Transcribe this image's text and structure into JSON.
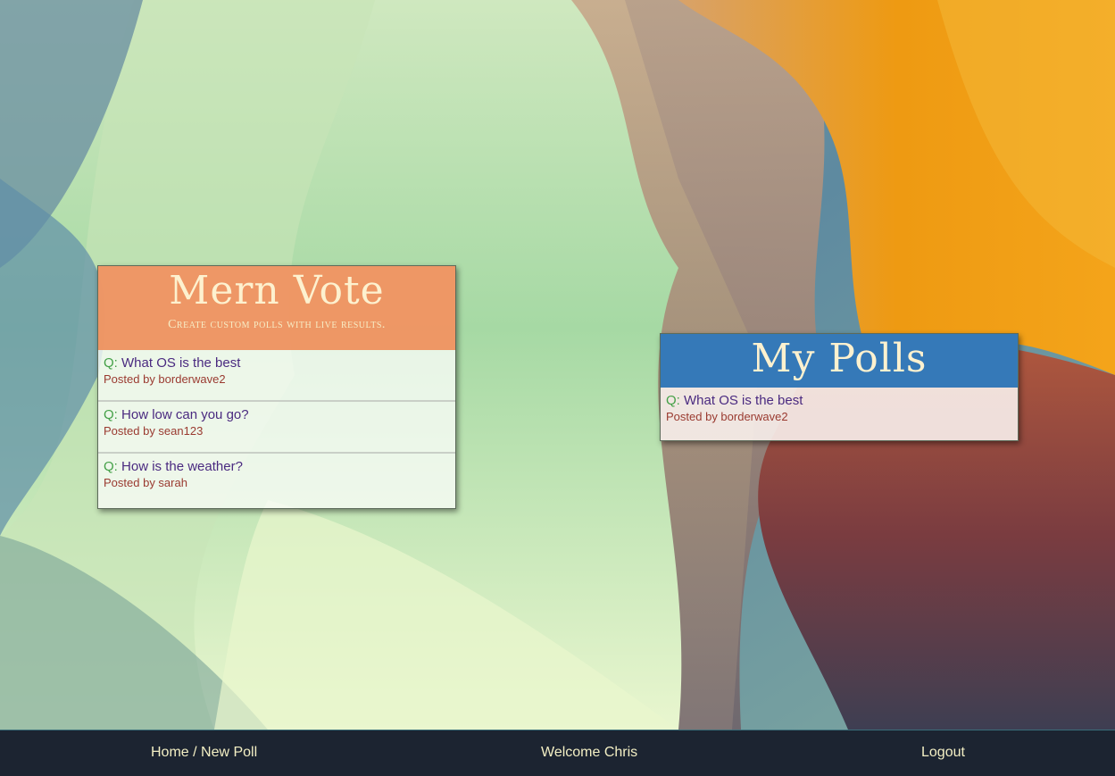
{
  "background": {
    "colors": [
      "#6e97a3",
      "#bfe0b6",
      "#9bd39d",
      "#e8f5c8",
      "#c99a78",
      "#e58c2b",
      "#ef9b0b",
      "#6a3a3e"
    ]
  },
  "feed_card": {
    "title": "Mern Vote",
    "subtitle": "Create custom polls with live results.",
    "header_color": "#ee8e5a",
    "polls": [
      {
        "q_label": "Q:",
        "question": "What OS is the best",
        "posted_by": "Posted by borderwave2"
      },
      {
        "q_label": "Q:",
        "question": "How low can you go?",
        "posted_by": "Posted by sean123"
      },
      {
        "q_label": "Q:",
        "question": "How is the weather?",
        "posted_by": "Posted by sarah"
      }
    ]
  },
  "my_polls_card": {
    "title": "My Polls",
    "header_color": "#3579b8",
    "polls": [
      {
        "q_label": "Q:",
        "question": "What OS is the best",
        "posted_by": "Posted by borderwave2"
      }
    ]
  },
  "footer": {
    "home_link": "Home / New Poll",
    "welcome": "Welcome Chris",
    "logout": "Logout",
    "bg_color": "#1c2431",
    "text_color": "#f3efc4"
  }
}
